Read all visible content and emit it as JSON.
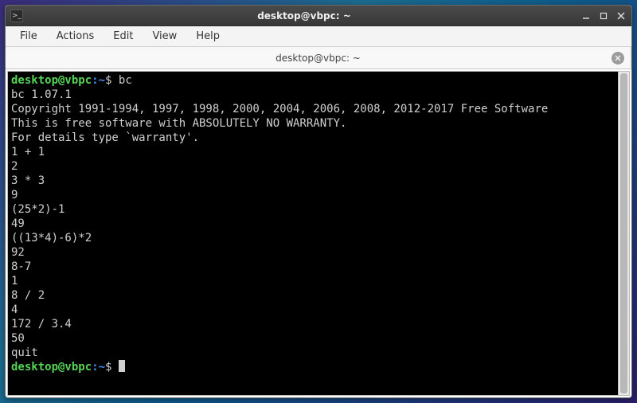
{
  "window": {
    "title": "desktop@vbpc: ~"
  },
  "menubar": {
    "items": [
      "File",
      "Actions",
      "Edit",
      "View",
      "Help"
    ]
  },
  "tabs": [
    {
      "label": "desktop@vbpc: ~"
    }
  ],
  "prompt": {
    "user": "desktop@vbpc",
    "sep": ":",
    "path": "~",
    "sigil": "$"
  },
  "session": {
    "cmd1": "bc",
    "lines": [
      "bc 1.07.1",
      "Copyright 1991-1994, 1997, 1998, 2000, 2004, 2006, 2008, 2012-2017 Free Software",
      "This is free software with ABSOLUTELY NO WARRANTY.",
      "For details type `warranty'.",
      "1 + 1",
      "2",
      "3 * 3",
      "9",
      "(25*2)-1",
      "49",
      "((13*4)-6)*2",
      "92",
      "8-7",
      "1",
      "8 / 2",
      "4",
      "172 / 3.4",
      "50",
      "quit"
    ]
  }
}
